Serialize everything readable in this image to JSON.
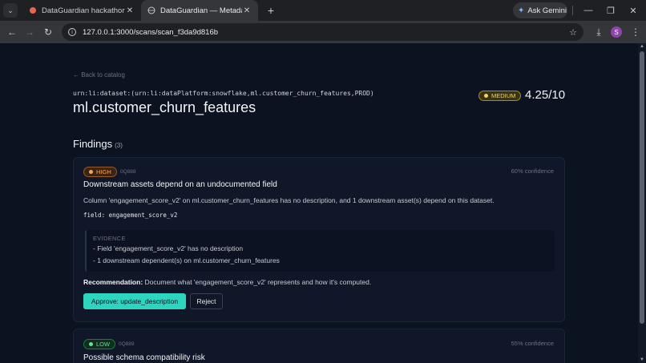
{
  "browser": {
    "tabs": [
      {
        "title": "DataGuardian hackathon proje",
        "active": false
      },
      {
        "title": "DataGuardian — Metadata-Aw",
        "active": true
      }
    ],
    "gemini_label": "Ask Gemini",
    "url": "127.0.0.1:3000/scans/scan_f3da9d816b",
    "profile_initial": "S"
  },
  "page": {
    "back_link": "← Back to catalog",
    "urn": "urn:li:dataset:(urn:li:dataPlatform:snowflake,ml.customer_churn_features,PROD)",
    "dataset_name": "ml.customer_churn_features",
    "severity": "MEDIUM",
    "score": "4.25/10",
    "findings_title": "Findings",
    "findings_count": "(3)",
    "findings": [
      {
        "severity": "HIGH",
        "id": "0Q888",
        "confidence": "60% confidence",
        "title": "Downstream assets depend on an undocumented field",
        "description": "Column 'engagement_score_v2' on ml.customer_churn_features has no description, and 1 downstream asset(s) depend on this dataset.",
        "field": "field: engagement_score_v2",
        "evidence_label": "EVIDENCE",
        "evidence": [
          "-  Field 'engagement_score_v2' has no description",
          "-  1 downstream dependent(s) on ml.customer_churn_features"
        ],
        "recommendation_label": "Recommendation:",
        "recommendation": " Document what 'engagement_score_v2' represents and how it's computed.",
        "approve_label": "Approve: update_description",
        "reject_label": "Reject"
      },
      {
        "severity": "LOW",
        "id": "0Q889",
        "confidence": "55% confidence",
        "title": "Possible schema compatibility risk"
      }
    ]
  },
  "colors": {
    "accent": "#2dd4bf",
    "medium": "#f3d26b",
    "high": "#f3a55b",
    "low": "#5ee39a"
  }
}
